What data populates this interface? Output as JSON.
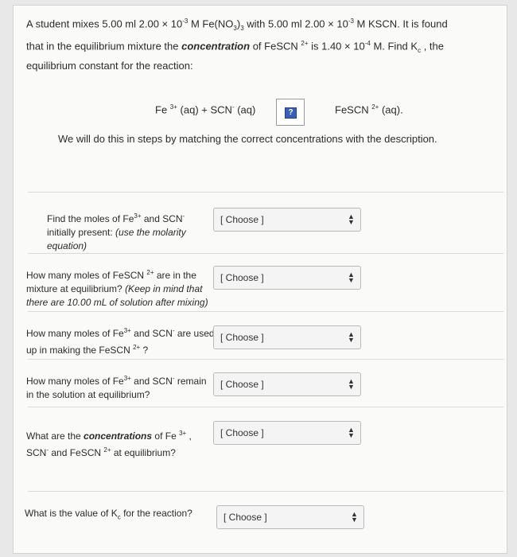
{
  "intro": {
    "line1": "A student mixes 5.00 ml 2.00 × 10",
    "exp1": "-3",
    "line1b": " M Fe(NO",
    "sub3": "3",
    "line1c": ")",
    "sub3b": "3",
    "line1d": " with 5.00 ml 2.00 × 10",
    "exp2": "-3",
    "line1e": " M KSCN.  It is found",
    "line2a": "that in the equilibrium mixture the ",
    "line2bold": "concentration",
    "line2b": " of FeSCN ",
    "exp3": "2+",
    "line2c": " is 1.40 × 10",
    "exp4": "-4",
    "line2d": " M.  Find K",
    "subc": "c",
    "line2e": " , the",
    "line3": "equilibrium constant for the reaction:"
  },
  "equation": {
    "left_a": "Fe ",
    "left_sup": "3+",
    "left_b": " (aq) + SCN",
    "left_sup2": "-",
    "left_c": " (aq)",
    "box_icon": "?",
    "right_a": "FeSCN ",
    "right_sup": "2+",
    "right_b": " (aq)."
  },
  "steps_note": "We will do this in steps by matching the correct concentrations with the description.",
  "questions": [
    {
      "pre": "Find the moles of Fe",
      "sup": "3+",
      "mid": " and SCN",
      "sup2": "-",
      "l2": "initially present:  ",
      "l2i": "(use the molarity",
      "l3i": "equation)",
      "select": "[ Choose ]"
    },
    {
      "pre": "How many moles of FeSCN ",
      "sup": "2+",
      "mid": " are in the",
      "l2": "mixture at equilibrium?  ",
      "l2i": "(Keep in mind that",
      "l3i": "there are 10.00 mL of solution after mixing)",
      "select": "[ Choose ]"
    },
    {
      "pre": "How many moles of Fe",
      "sup": "3+",
      "mid": " and SCN",
      "sup2": "-",
      "mid2": " are used",
      "l2": "up in making the FeSCN ",
      "l2sup": "2+",
      "l2end": " ?",
      "select": "[ Choose ]"
    },
    {
      "pre": "How many moles of Fe",
      "sup": "3+",
      "mid": " and SCN",
      "sup2": "-",
      "mid2": "  remain",
      "l2": "in the solution at equilibrium?",
      "select": "[ Choose ]"
    },
    {
      "pre": "What are the ",
      "bold": "concentrations",
      "mid": " of Fe ",
      "sup": "3+",
      "mid2": " ,",
      "l2": "SCN",
      "l2sup": "-",
      "l2b": " and FeSCN ",
      "l2sup2": "2+",
      "l2end": " at equilibrium?",
      "select": "[ Choose ]"
    },
    {
      "pre": "What is the value of K",
      "sub": "c",
      "mid": " for the reaction?",
      "select": "[ Choose ]"
    }
  ],
  "icons": {
    "select_arrows": "chevron-updown-icon",
    "help": "question-icon"
  }
}
